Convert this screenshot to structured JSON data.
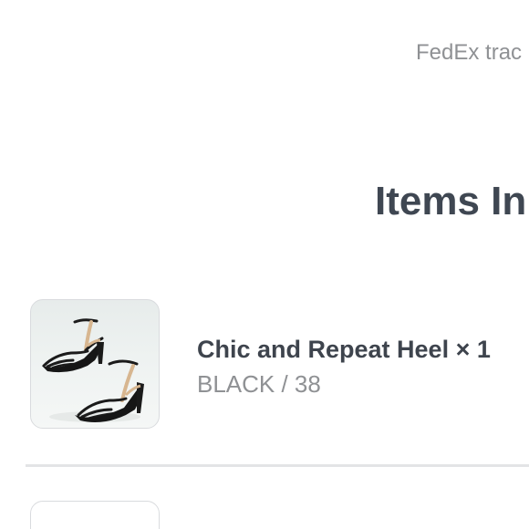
{
  "shipping": {
    "tracking_text": "FedEx trac"
  },
  "section": {
    "title": "Items In"
  },
  "items": [
    {
      "name": "Chic and Repeat Heel × 1",
      "variant": "BLACK / 38",
      "image_icon": "heel-shoe-icon"
    }
  ],
  "colors": {
    "title": "#3f4752",
    "muted": "#8f9194",
    "divider": "#e3e4e6"
  }
}
